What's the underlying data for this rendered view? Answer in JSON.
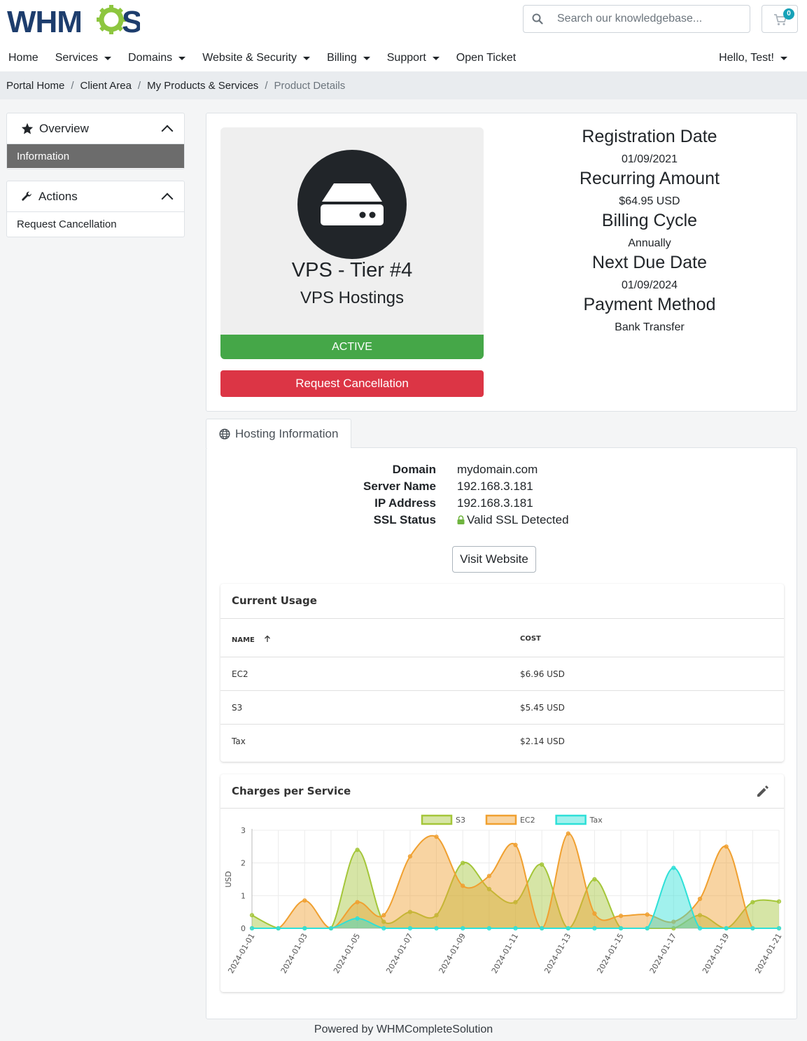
{
  "brand": {
    "logo_text_left": "WHM",
    "logo_text_right": "S",
    "gear_color": "#8dc63f",
    "text_color": "#1d3d6d"
  },
  "search": {
    "placeholder": "Search our knowledgebase..."
  },
  "cart": {
    "count": "0",
    "icon": "cart-icon"
  },
  "nav": {
    "items": [
      "Home",
      "Services",
      "Domains",
      "Website & Security",
      "Billing",
      "Support",
      "Open Ticket"
    ],
    "user_menu": "Hello, Test!"
  },
  "breadcrumb": [
    "Portal Home",
    "Client Area",
    "My Products & Services",
    "Product Details"
  ],
  "sidebar": {
    "overview": {
      "title": "Overview",
      "icon": "star-icon",
      "items": [
        "Information"
      ]
    },
    "actions": {
      "title": "Actions",
      "icon": "wrench-icon",
      "items": [
        "Request Cancellation"
      ]
    }
  },
  "product": {
    "icon": "server-icon",
    "name": "VPS - Tier #4",
    "group": "VPS Hostings",
    "status": "ACTIVE",
    "status_color": "#45a748",
    "cancel_label": "Request Cancellation"
  },
  "details": [
    {
      "label": "Registration Date",
      "value": "01/09/2021"
    },
    {
      "label": "Recurring Amount",
      "value": "$64.95 USD"
    },
    {
      "label": "Billing Cycle",
      "value": "Annually"
    },
    {
      "label": "Next Due Date",
      "value": "01/09/2024"
    },
    {
      "label": "Payment Method",
      "value": "Bank Transfer"
    }
  ],
  "hosting": {
    "tab_label": "Hosting Information",
    "tab_icon": "globe-icon",
    "rows": [
      {
        "key": "Domain",
        "value": "mydomain.com"
      },
      {
        "key": "Server Name",
        "value": "192.168.3.181"
      },
      {
        "key": "IP Address",
        "value": "192.168.3.181"
      },
      {
        "key": "SSL Status",
        "value": "Valid SSL Detected"
      }
    ],
    "visit_label": "Visit Website"
  },
  "usage": {
    "title": "Current Usage",
    "columns": [
      "NAME",
      "COST"
    ],
    "rows": [
      {
        "name": "EC2",
        "cost": "$6.96 USD"
      },
      {
        "name": "S3",
        "cost": "$5.45 USD"
      },
      {
        "name": "Tax",
        "cost": "$2.14 USD"
      }
    ]
  },
  "charges": {
    "title": "Charges per Service",
    "edit_icon": "pencil-icon"
  },
  "chart_data": {
    "type": "area",
    "ylabel": "USD",
    "ylim": [
      0,
      3
    ],
    "yticks": [
      "0",
      "1",
      "2",
      "3"
    ],
    "legend_position": "top",
    "x": [
      "2024-01-01",
      "2024-01-02",
      "2024-01-03",
      "2024-01-04",
      "2024-01-05",
      "2024-01-06",
      "2024-01-07",
      "2024-01-08",
      "2024-01-09",
      "2024-01-10",
      "2024-01-11",
      "2024-01-12",
      "2024-01-13",
      "2024-01-14",
      "2024-01-15",
      "2024-01-16",
      "2024-01-17",
      "2024-01-18",
      "2024-01-19",
      "2024-01-20",
      "2024-01-21"
    ],
    "xtick_labels": [
      "2024-01-01",
      "2024-01-03",
      "2024-01-05",
      "2024-01-07",
      "2024-01-09",
      "2024-01-11",
      "2024-01-13",
      "2024-01-15",
      "2024-01-17",
      "2024-01-19",
      "2024-01-21"
    ],
    "series": [
      {
        "name": "S3",
        "color": "#a4c639",
        "values": [
          0.4,
          0.0,
          0.0,
          0.0,
          2.4,
          0.2,
          0.5,
          0.4,
          2.0,
          1.2,
          0.8,
          1.95,
          0.0,
          1.5,
          0.0,
          0.0,
          0.0,
          0.4,
          0.0,
          0.8,
          0.82
        ]
      },
      {
        "name": "EC2",
        "color": "#f0a030",
        "values": [
          0.0,
          0.0,
          0.85,
          0.0,
          0.8,
          0.4,
          2.2,
          2.8,
          1.3,
          1.6,
          2.55,
          0.0,
          2.9,
          0.45,
          0.38,
          0.42,
          0.2,
          0.9,
          2.5,
          0.0,
          0.0
        ]
      },
      {
        "name": "Tax",
        "color": "#2ee0d8",
        "values": [
          0.0,
          0.0,
          0.0,
          0.0,
          0.3,
          0.0,
          0.0,
          0.0,
          0.0,
          0.0,
          0.0,
          0.0,
          0.0,
          0.0,
          0.0,
          0.0,
          1.85,
          0.0,
          0.0,
          0.0,
          0.0
        ]
      }
    ]
  },
  "footer": {
    "text": "Powered by WHMCompleteSolution"
  }
}
